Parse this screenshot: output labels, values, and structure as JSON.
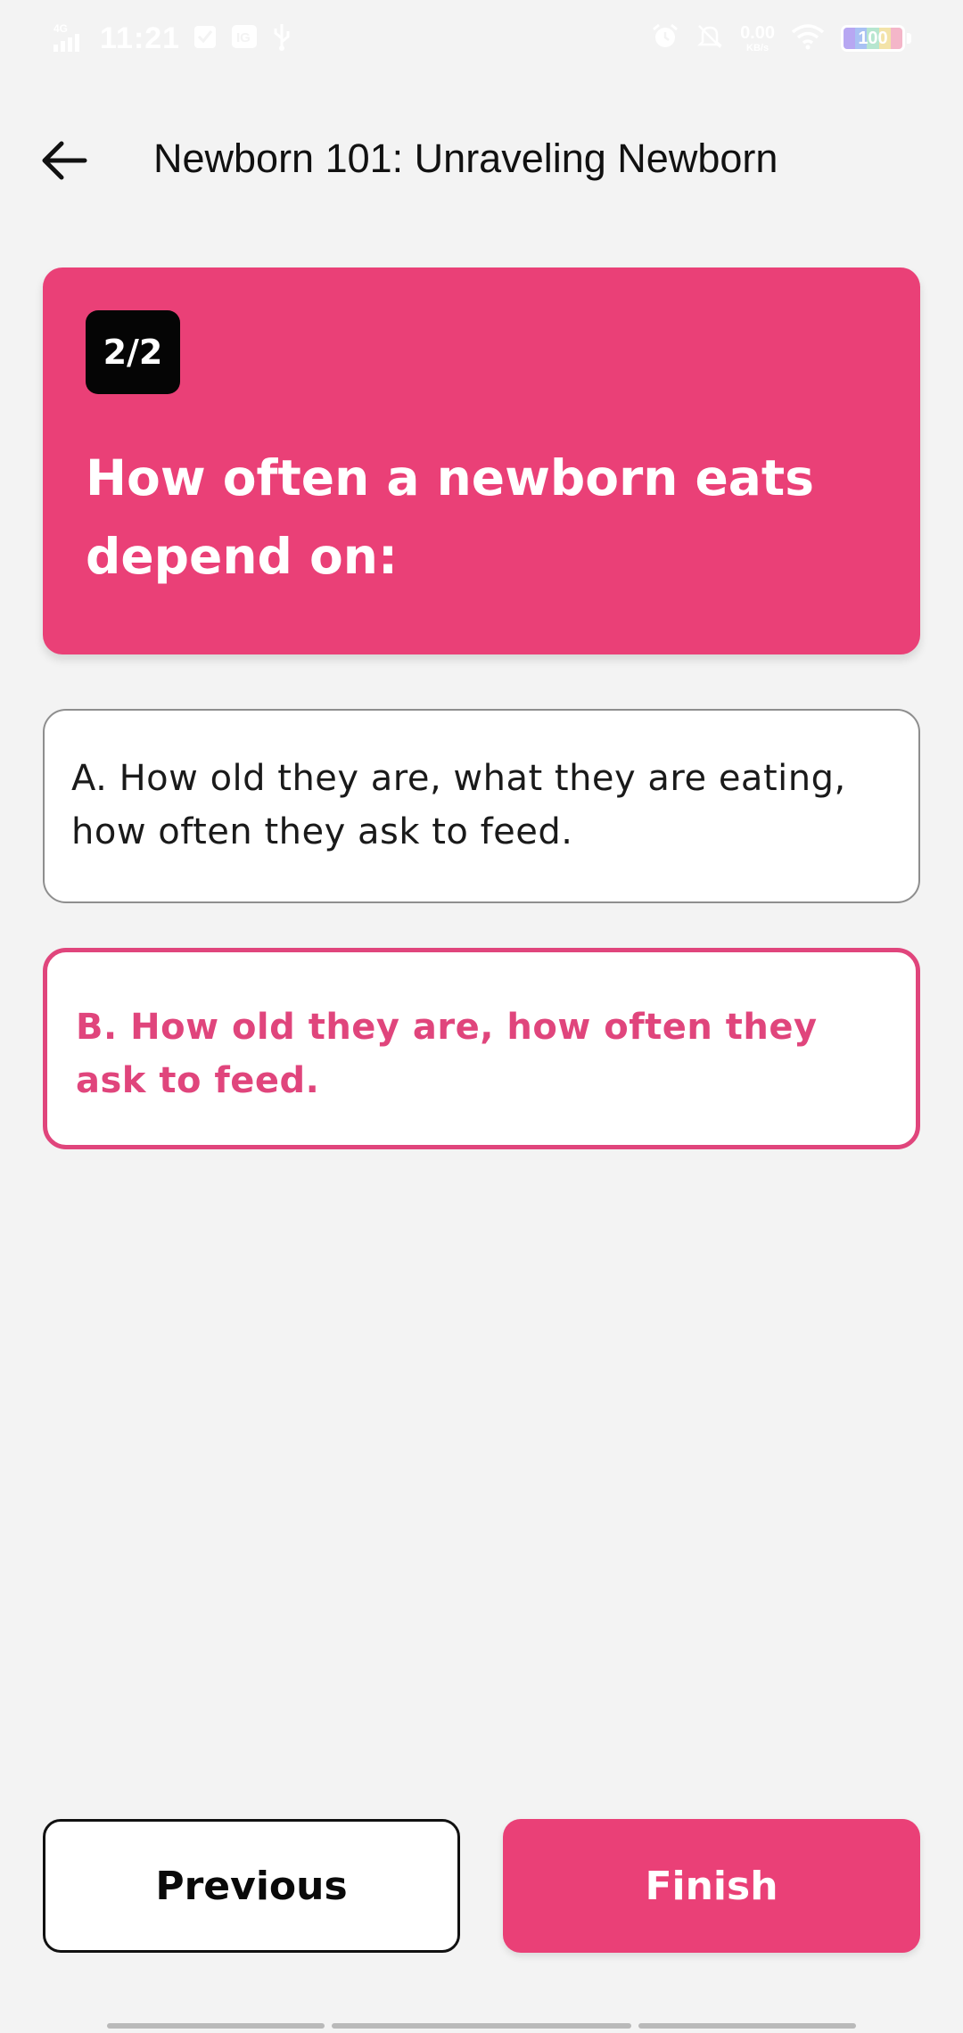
{
  "status_bar": {
    "network": "4G",
    "time": "11:21",
    "net_speed_value": "0.00",
    "net_speed_unit": "KB/s",
    "battery_level": "100",
    "icons": [
      "signal-icon",
      "check-icon",
      "notification-icon",
      "usb-icon",
      "alarm-icon",
      "mute-icon",
      "wifi-icon",
      "battery-icon"
    ]
  },
  "app_bar": {
    "title": "Newborn 101: Unraveling Newborn"
  },
  "question": {
    "counter": "2/2",
    "text": "How often a newborn eats depend on:"
  },
  "answers": [
    {
      "label": "A. How old they are, what they are eating, how often they ask to feed.",
      "selected": false
    },
    {
      "label": "B. How old they are, how often they ask to feed.",
      "selected": true
    }
  ],
  "buttons": {
    "previous": "Previous",
    "finish": "Finish"
  },
  "colors": {
    "accent": "#ea4077",
    "selected_text": "#e0457c",
    "background": "#f3f3f3",
    "counter_bg": "#050505"
  }
}
